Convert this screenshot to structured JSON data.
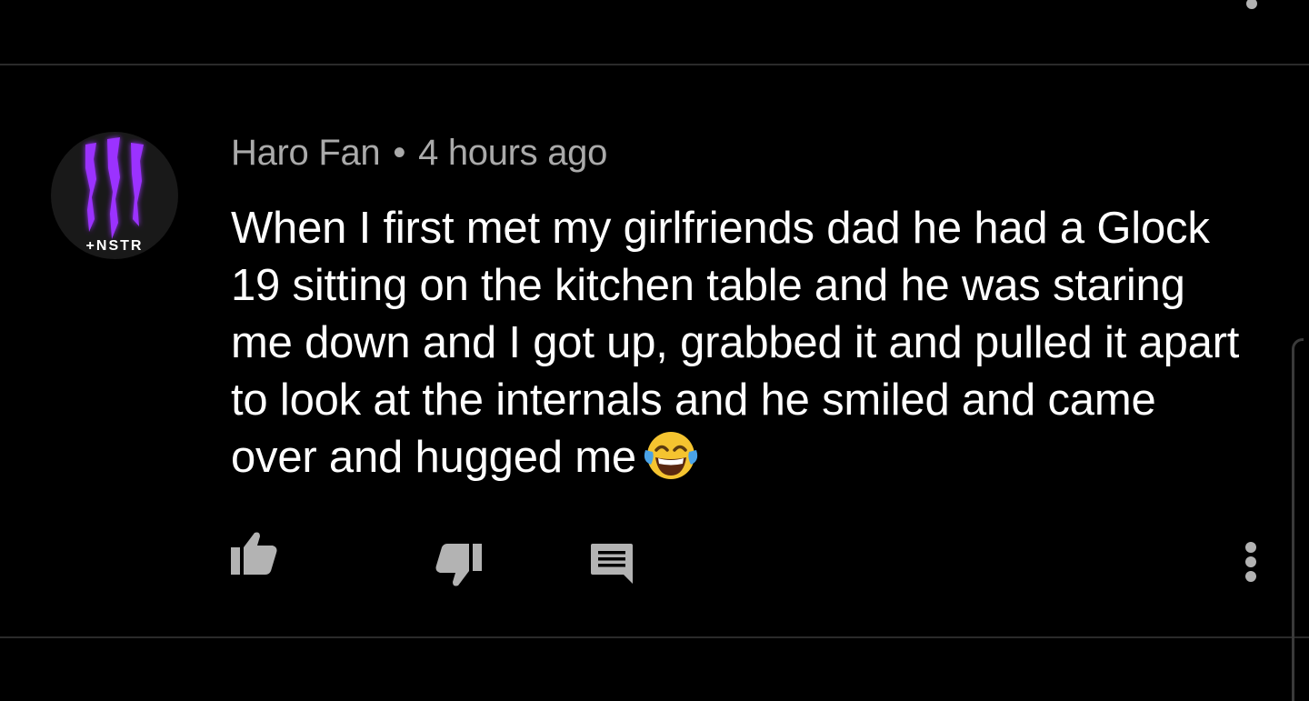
{
  "comment": {
    "author": "Haro Fan",
    "separator": "•",
    "timestamp": "4 hours ago",
    "text": "When I first met my girlfriends dad he had a Glock 19 sitting on the kitchen table and he was staring me down and I got up, grabbed it and pulled it apart to look at the internals and he smiled and came over and hugged me",
    "emoji": "face-with-tears-of-joy",
    "avatar": {
      "icon": "monster-energy-logo-icon",
      "accent": "#8a2be2"
    }
  },
  "actions": {
    "like_icon": "thumbs-up-icon",
    "dislike_icon": "thumbs-down-icon",
    "reply_icon": "reply-comment-icon",
    "more_icon": "more-vertical-icon"
  },
  "colors": {
    "background": "#000000",
    "meta": "#aaaaaa",
    "icons": "#b3b3b3",
    "divider": "#2a2a2a"
  }
}
